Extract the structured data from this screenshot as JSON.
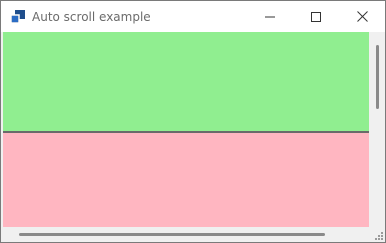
{
  "window": {
    "title": "Auto scroll example",
    "icon": "app-window-icon",
    "controls": [
      "minimize-icon",
      "maximize-icon",
      "close-icon"
    ]
  },
  "panels": [
    {
      "name": "green-panel",
      "color": "#90ee90"
    },
    {
      "name": "pink-panel",
      "color": "#ffb6c1"
    }
  ],
  "scrollbars": {
    "vertical": true,
    "horizontal": true
  }
}
